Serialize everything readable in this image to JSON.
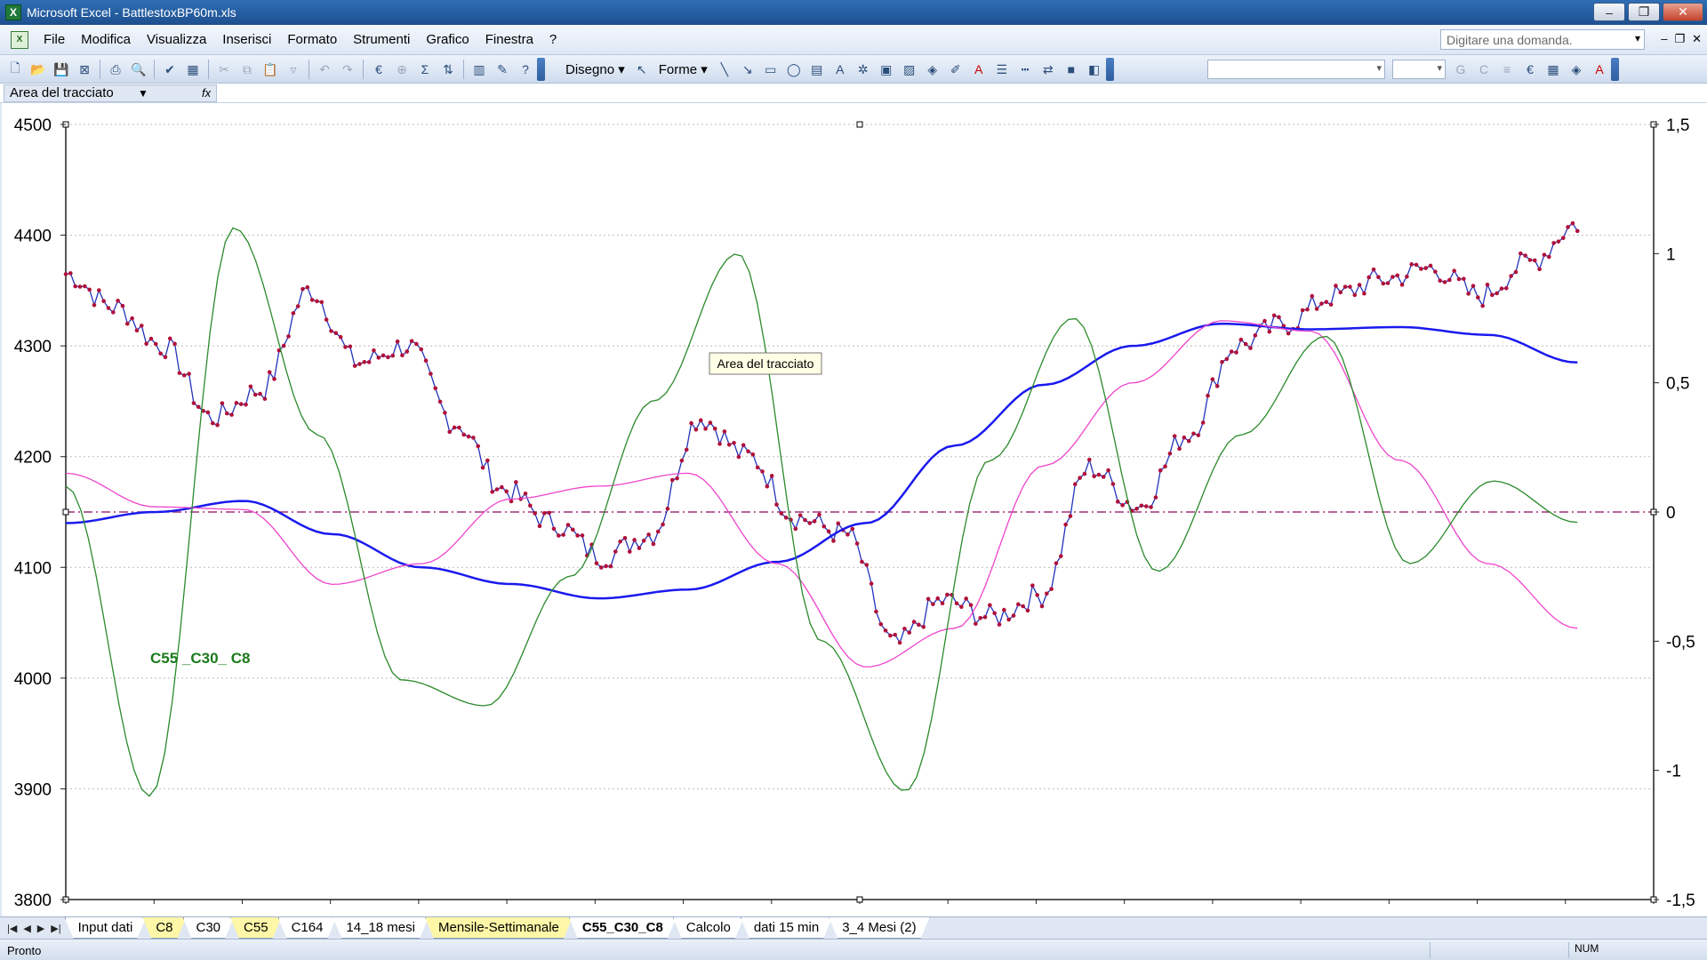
{
  "window": {
    "title": "Microsoft Excel - BattlestoxBP60m.xls",
    "app_icon": "excel-icon"
  },
  "menu": {
    "items": [
      "File",
      "Modifica",
      "Visualizza",
      "Inserisci",
      "Formato",
      "Strumenti",
      "Grafico",
      "Finestra",
      "?"
    ],
    "help_placeholder": "Digitare una domanda."
  },
  "toolbar": {
    "draw_label": "Disegno",
    "shapes_label": "Forme"
  },
  "formula_bar": {
    "name_box": "Area del tracciato"
  },
  "chart": {
    "tooltip": "Area del tracciato",
    "annotation": "C55 _C30_ C8",
    "left_axis_ticks": [
      "4500",
      "4400",
      "4300",
      "4200",
      "4100",
      "4000",
      "3900",
      "3800"
    ],
    "right_axis_ticks": [
      "1,5",
      "1",
      "0,5",
      "0",
      "-0,5",
      "-1",
      "-1,5"
    ]
  },
  "chart_data": {
    "type": "line",
    "title": "",
    "annotation": "C55 _C30_ C8",
    "y_left": {
      "range": [
        3800,
        4500
      ],
      "ticks": [
        4500,
        4400,
        4300,
        4200,
        4100,
        4000,
        3900,
        3800
      ]
    },
    "y_right": {
      "range": [
        -1.5,
        1.5
      ],
      "ticks": [
        1.5,
        1,
        0.5,
        0,
        -0.5,
        -1,
        -1.5
      ]
    },
    "grid": "horizontal dotted",
    "x_points": 18,
    "series": [
      {
        "axis": "left",
        "color": "#2233bb",
        "marker": "#b0103a",
        "style": "price",
        "values": [
          4365,
          4335,
          4300,
          4235,
          4260,
          4350,
          4285,
          4300,
          4230,
          4170,
          4140,
          4110,
          4130,
          4235,
          4200,
          4145,
          4130,
          4030,
          4070,
          4055,
          4075,
          4190,
          4155,
          4220,
          4300,
          4320,
          4345,
          4360,
          4370,
          4345,
          4375,
          4410
        ]
      },
      {
        "axis": "left",
        "color": "#1a1aee",
        "style": "smooth",
        "values": [
          4140,
          4150,
          4160,
          4130,
          4100,
          4085,
          4072,
          4080,
          4105,
          4140,
          4210,
          4265,
          4300,
          4320,
          4315,
          4317,
          4310,
          4285
        ]
      },
      {
        "axis": "right",
        "color": "#ee44cc",
        "style": "smooth",
        "values": [
          0.15,
          0.02,
          0.01,
          -0.28,
          -0.2,
          0.05,
          0.1,
          0.15,
          -0.2,
          -0.6,
          -0.45,
          0.18,
          0.5,
          0.74,
          0.7,
          0.2,
          -0.2,
          -0.45
        ]
      },
      {
        "axis": "right",
        "color": "#2a8a2a",
        "style": "smooth",
        "values": [
          0.1,
          -1.1,
          1.1,
          0.3,
          -0.65,
          -0.75,
          -0.25,
          0.43,
          1.0,
          -0.5,
          -1.08,
          0.2,
          0.75,
          -0.23,
          0.3,
          0.68,
          -0.2,
          0.12,
          -0.04
        ]
      }
    ]
  },
  "sheet_tabs": {
    "items": [
      "Input dati",
      "C8",
      "C30",
      "C55",
      "C164",
      "14_18 mesi",
      "Mensile-Settimanale",
      "C55_C30_C8",
      "Calcolo",
      "dati 15 min",
      "3_4 Mesi (2)"
    ],
    "active": "C55_C30_C8",
    "yellow": [
      "C8",
      "C55",
      "Mensile-Settimanale"
    ]
  },
  "status": {
    "left": "Pronto",
    "num": "NUM"
  }
}
